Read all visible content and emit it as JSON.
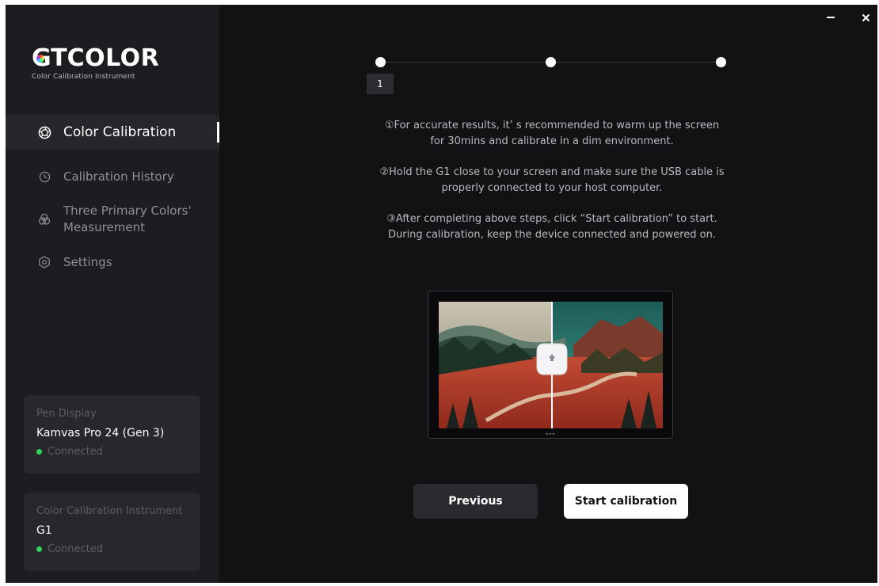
{
  "window": {
    "minimize_icon": "minimize-icon",
    "close_icon": "close-icon"
  },
  "sidebar": {
    "logo": {
      "brand": "COLOR",
      "brand_prefix": "GT",
      "subtitle": "Color Calibration Instrument"
    },
    "nav": [
      {
        "label": "Color Calibration",
        "icon": "aperture-icon",
        "active": true
      },
      {
        "label": "Calibration History",
        "icon": "clock-icon",
        "active": false
      },
      {
        "label": "Three Primary Colors' Measurement",
        "label_line1": "Three Primary Colors'",
        "label_line2": "Measurement",
        "icon": "rgb-circles-icon",
        "active": false
      },
      {
        "label": "Settings",
        "icon": "gear-hexagon-icon",
        "active": false
      }
    ],
    "devices": [
      {
        "label": "Pen Display",
        "name": "Kamvas Pro 24 (Gen 3)",
        "status": "Connected",
        "status_color": "#2fd25a"
      },
      {
        "label": "Color Calibration Instrument",
        "name": "G1",
        "status": "Connected",
        "status_color": "#2fd25a"
      }
    ]
  },
  "main": {
    "stepper": {
      "total_steps": 3,
      "current_step": 1,
      "current_label": "1"
    },
    "instructions": [
      {
        "line1": "①For accurate results, it’ s recommended to warm up the screen",
        "line2": "for 30mins and calibrate in a dim environment."
      },
      {
        "line1": "②Hold the G1 close to your screen and make sure the USB cable is",
        "line2": "properly connected to your host computer."
      },
      {
        "line1": "③After completing above steps, click  “Start calibration”  to start.",
        "line2": "During calibration, keep the device connected and powered on."
      }
    ],
    "buttons": {
      "previous": "Previous",
      "start": "Start calibration"
    }
  },
  "colors": {
    "background": "#121215",
    "sidebar": "#1c1c21",
    "accent": "#ffffff",
    "status_connected": "#2fd25a"
  }
}
